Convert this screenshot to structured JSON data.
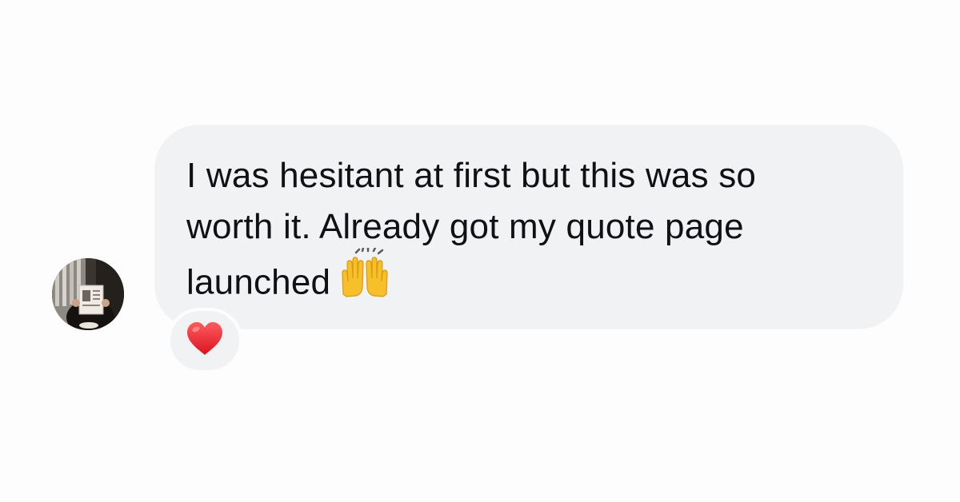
{
  "message": {
    "lines": [
      "I was hesitant at first but this was so",
      "worth it. Already got my quote page",
      "launched"
    ],
    "trailing_emoji": "raising-hands-emoji"
  },
  "reaction": {
    "emoji": "red-heart-emoji"
  },
  "colors": {
    "background": "#fdfdfd",
    "bubble": "#f1f2f4",
    "text": "#101114",
    "heart": "#e8232d",
    "hands": "#f7c02a"
  }
}
